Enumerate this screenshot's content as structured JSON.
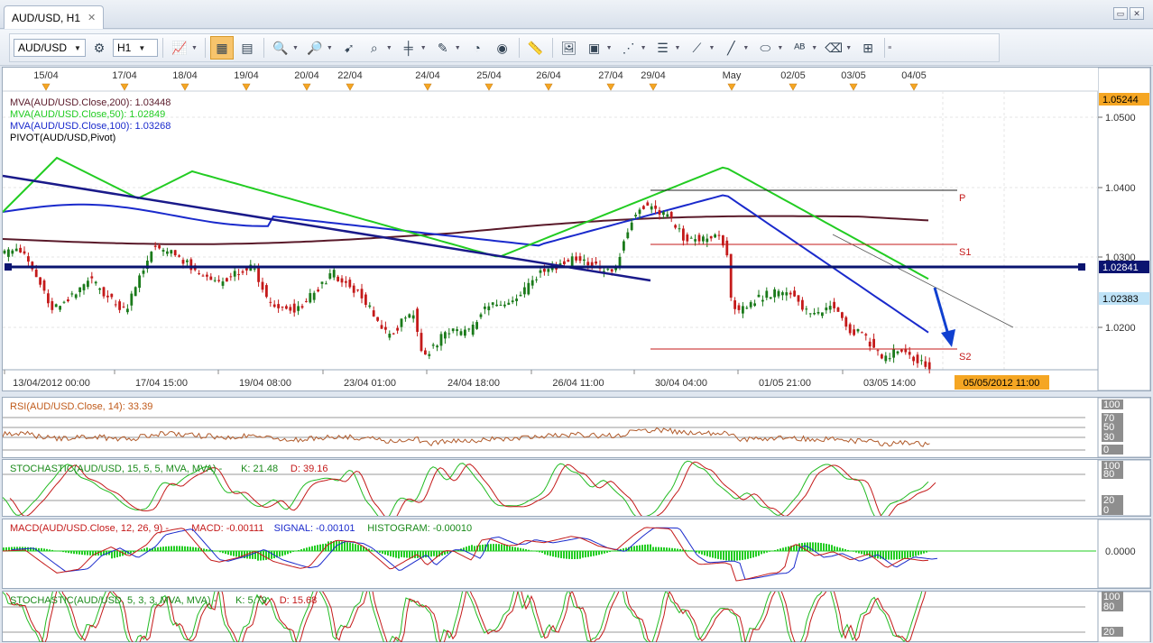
{
  "tab": {
    "title": "AUD/USD, H1",
    "close": "✕"
  },
  "window_buttons": [
    "▭",
    "✕"
  ],
  "toolbar": {
    "symbol": "AUD/USD",
    "timeframe": "H1",
    "tools": [
      "bar-chart-icon",
      "candle-settings-icon",
      "chart-type-icon",
      "data-table-icon",
      "zoom-in-icon",
      "zoom-out-icon",
      "pointer-icon",
      "zoom-window-icon",
      "crosshair-icon",
      "draw-cursor-icon",
      "magnet-icon",
      "globe-icon",
      "ruler-icon",
      "picture-icon",
      "template-icon",
      "fan-icon",
      "levels-icon",
      "trendline-icon",
      "line-icon",
      "ellipse-icon",
      "text-icon",
      "eraser-icon",
      "tree-icon"
    ]
  },
  "colors": {
    "up": "#1a7a1a",
    "down": "#c41a1a",
    "mva200": "#5a1a2a",
    "mva50": "#22cc22",
    "mva100": "#1a2acc",
    "pivot_blue": "#1a1a8a",
    "arrow": "#1040d0",
    "price_tag_orange": "#f5a623",
    "price_tag_blue": "#0a1470"
  },
  "top_dates": [
    "15/04",
    "17/04",
    "18/04",
    "19/04",
    "20/04",
    "22/04",
    "24/04",
    "25/04",
    "26/04",
    "27/04",
    "29/04",
    "May",
    "02/05",
    "03/05",
    "04/05"
  ],
  "bottom_dates": [
    "13/04/2012 00:00",
    "17/04 15:00",
    "19/04 08:00",
    "23/04 01:00",
    "24/04 18:00",
    "26/04 11:00",
    "30/04 04:00",
    "01/05 21:00",
    "03/05 14:00"
  ],
  "cursor_date": "05/05/2012 11:00",
  "main": {
    "legend": [
      {
        "text": "MVA(AUD/USD.Close,200): 1.03448",
        "color": "#5a1a2a"
      },
      {
        "text": "MVA(AUD/USD.Close,50): 1.02849",
        "color": "#22cc22"
      },
      {
        "text": "MVA(AUD/USD.Close,100): 1.03268",
        "color": "#1a2acc"
      },
      {
        "text": "PIVOT(AUD/USD,Pivot)",
        "color": "#000000"
      }
    ],
    "price_ticks": [
      "1.0500",
      "1.0400",
      "1.0300",
      "1.0200"
    ],
    "price_high_tag": "1.05244",
    "price_line_tag": "1.02841",
    "price_current_tag": "1.02383",
    "pivot_labels": {
      "p": "P",
      "s1": "S1",
      "s2": "S2"
    }
  },
  "rsi": {
    "label": "RSI(AUD/USD.Close, 14): 33.39",
    "ticks": [
      "100",
      "70",
      "50",
      "30",
      "0"
    ]
  },
  "stoch1": {
    "label_a": "STOCHASTIC(AUD/USD, 15, 5, 5, MVA, MVA) -",
    "label_k": "K: 21.48",
    "label_d": "D: 39.16",
    "ticks": [
      "100",
      "80",
      "20",
      "0"
    ]
  },
  "macd": {
    "label_a": "MACD(AUD/USD.Close, 12, 26, 9) -",
    "label_macd": "MACD: -0.00111",
    "label_signal": "SIGNAL: -0.00101",
    "label_hist": "HISTOGRAM: -0.00010",
    "ticks": [
      "0.0000"
    ]
  },
  "stoch2": {
    "label_a": "STOCHASTIC(AUD/USD, 5, 3, 3, MVA, MVA) -",
    "label_k": "K: 5.79",
    "label_d": "D: 15.68",
    "ticks": [
      "100",
      "80",
      "20"
    ]
  }
}
